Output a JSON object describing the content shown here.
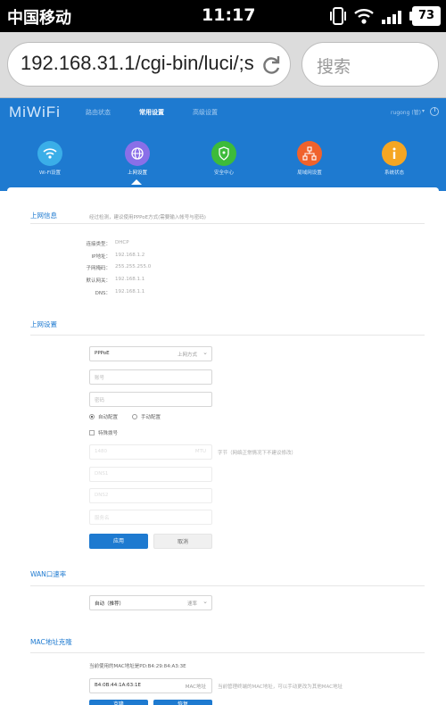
{
  "status_bar": {
    "carrier": "中国移动",
    "time": "11:17",
    "battery": "73",
    "icons": [
      "vibrate-icon",
      "wifi-icon",
      "signal-icon",
      "battery-icon"
    ]
  },
  "browser": {
    "url": "192.168.31.1/cgi-bin/luci/;s",
    "search_placeholder": "搜索"
  },
  "router": {
    "logo": "MiWiFi",
    "nav": [
      "路由状态",
      "常用设置",
      "高级设置"
    ],
    "active_nav": "常用设置",
    "user": "rugong (管)",
    "user_caret": "▾",
    "icons": [
      {
        "label": "Wi-Fi设置",
        "icon": "wifi-icon",
        "color": "#3aaee8"
      },
      {
        "label": "上网设置",
        "icon": "globe-icon",
        "color": "#8a6fe8"
      },
      {
        "label": "安全中心",
        "icon": "shield-icon",
        "color": "#3dbb3a"
      },
      {
        "label": "局域网设置",
        "icon": "network-icon",
        "color": "#f0622c"
      },
      {
        "label": "系统状态",
        "icon": "info-icon",
        "color": "#f5a623"
      }
    ]
  },
  "sections": {
    "info": {
      "title": "上网信息",
      "desc": "经过检测，建议使用PPPoE方式(需要输入帐号与密码)",
      "rows": [
        {
          "label": "连接类型：",
          "value": "DHCP"
        },
        {
          "label": "IP地址：",
          "value": "192.168.1.2"
        },
        {
          "label": "子网掩码：",
          "value": "255.255.255.0"
        },
        {
          "label": "默认网关：",
          "value": "192.168.1.1"
        },
        {
          "label": "DNS：",
          "value": "192.168.1.1"
        }
      ]
    },
    "settings": {
      "title": "上网设置",
      "mode_value": "PPPoE",
      "mode_label": "上网方式",
      "account_placeholder": "账号",
      "password_placeholder": "密码",
      "dns_auto": "自动配置",
      "dns_manual": "手动配置",
      "special_dial": "特殊拨号",
      "mtu_value": "1480",
      "mtu_unit": "MTU",
      "mtu_hint": "字节（网络正常情况下不建议修改）",
      "dns1_placeholder": "DNS1",
      "dns2_placeholder": "DNS2",
      "service_placeholder": "服务名",
      "apply": "应用",
      "cancel": "取消"
    },
    "wan": {
      "title": "WAN口速率",
      "value": "自动（推荐）",
      "label": "速率"
    },
    "mac": {
      "title": "MAC地址克隆",
      "current": "当前使用的MAC地址是PD:B4:29:84:A3:3E",
      "value": "B4:0B:44:1A:63:1E",
      "label": "MAC地址",
      "hint": "当前管理终端的MAC地址，可以手动更改为其他MAC地址",
      "btn1": "克隆",
      "btn2": "恢复"
    }
  }
}
